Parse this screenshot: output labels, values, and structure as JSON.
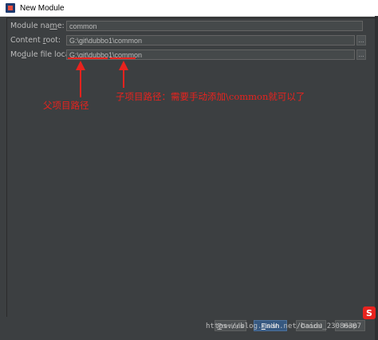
{
  "window": {
    "title": "New Module"
  },
  "form": {
    "module_name": {
      "label_pre": "Module na",
      "label_u": "m",
      "label_post": "e:",
      "value": "common"
    },
    "content_root": {
      "label_pre": "Content ",
      "label_u": "r",
      "label_post": "oot:",
      "value": "G:\\git\\dubbo1\\common"
    },
    "module_file_location": {
      "label_pre": "Mo",
      "label_u": "d",
      "label_post": "ule file location:",
      "value": "G:\\git\\dubbo1\\common"
    }
  },
  "annotations": {
    "parent_path": "父项目路径",
    "child_path": "子项目路径：需要手动添加\\common就可以了"
  },
  "buttons": {
    "previous_pre": "",
    "previous_u": "P",
    "previous_post": "revious",
    "finish_pre": "",
    "finish_u": "F",
    "finish_post": "inish",
    "cancel": "Cancel",
    "help": "Help"
  },
  "watermark": "https://blog.csdn.net/baidu_23086307",
  "icons": [
    "app-icon",
    "folder-browse-icon",
    "logo-icon"
  ],
  "colors": {
    "background": "#3c3f41",
    "annotation": "#e8231e",
    "primary_button": "#365880"
  }
}
